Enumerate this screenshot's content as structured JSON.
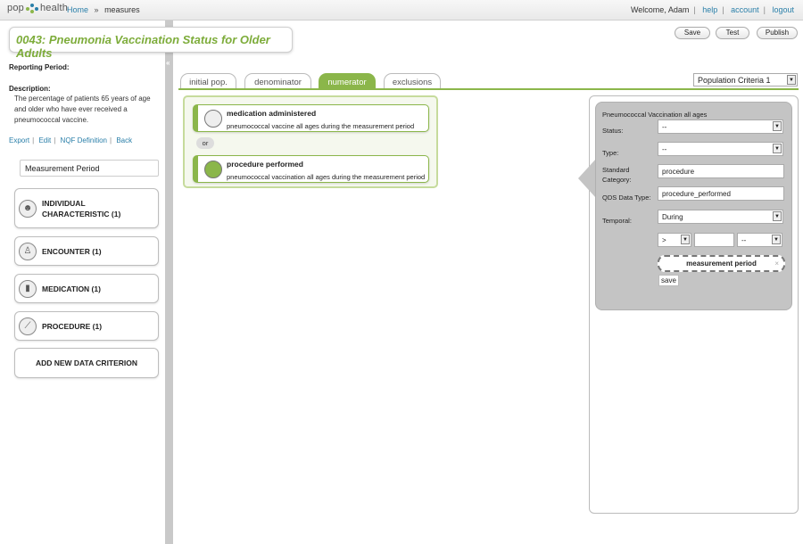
{
  "topbar": {
    "logo": {
      "left": "pop",
      "right": "health"
    },
    "breadcrumb": {
      "home": "Home",
      "sep": "»",
      "current": "measures"
    },
    "welcome": "Welcome, Adam",
    "links": {
      "help": "help",
      "account": "account",
      "logout": "logout"
    }
  },
  "measure": {
    "title": "0043: Pneumonia Vaccination Status for Older Adults"
  },
  "toolbar": {
    "save": "Save",
    "test": "Test",
    "publish": "Publish"
  },
  "sidebar": {
    "reporting_period_label": "Reporting Period:",
    "description_label": "Description:",
    "description": "The percentage of patients 65 years of age and older who have ever received a pneumococcal vaccine.",
    "links": {
      "export": "Export",
      "edit": "Edit",
      "nqf": "NQF Definition",
      "back": "Back"
    },
    "measurement_period": "Measurement Period",
    "categories": [
      {
        "label": "INDIVIDUAL CHARACTERISTIC (1)",
        "icon": "people-icon"
      },
      {
        "label": "ENCOUNTER (1)",
        "icon": "doctor-icon"
      },
      {
        "label": "MEDICATION (1)",
        "icon": "pill-bottle-icon"
      },
      {
        "label": "PROCEDURE (1)",
        "icon": "syringe-icon"
      },
      {
        "label": "ADD NEW DATA CRITERION"
      }
    ]
  },
  "tabs": [
    "initial pop.",
    "denominator",
    "numerator",
    "exclusions"
  ],
  "active_tab": "numerator",
  "population_select": "Population Criteria 1",
  "numerator": {
    "criteria": [
      {
        "title": "medication administered",
        "subtitle": "pneumococcal vaccine all ages during the measurement period"
      },
      {
        "title": "procedure performed",
        "subtitle": "pneumococcal vaccination all ages during the measurement period"
      }
    ],
    "connector": "or"
  },
  "editor": {
    "title": "Pneumococcal Vaccination all ages",
    "status_label": "Status:",
    "status_value": "--",
    "type_label": "Type:",
    "type_value": "--",
    "std_category_label": "Standard Category:",
    "std_category_value": "procedure",
    "qds_label": "QDS Data Type:",
    "qds_value": "procedure_performed",
    "temporal_label": "Temporal:",
    "temporal_value": "During",
    "operator_value": ">",
    "quantity_value": "",
    "unit_value": "--",
    "target": "measurement period",
    "remove_glyph": "×",
    "save": "save"
  },
  "colors": {
    "accent": "#8bb64a",
    "title": "#7dac3a",
    "link": "#2a7fa9",
    "panel": "#c4c4c4"
  }
}
